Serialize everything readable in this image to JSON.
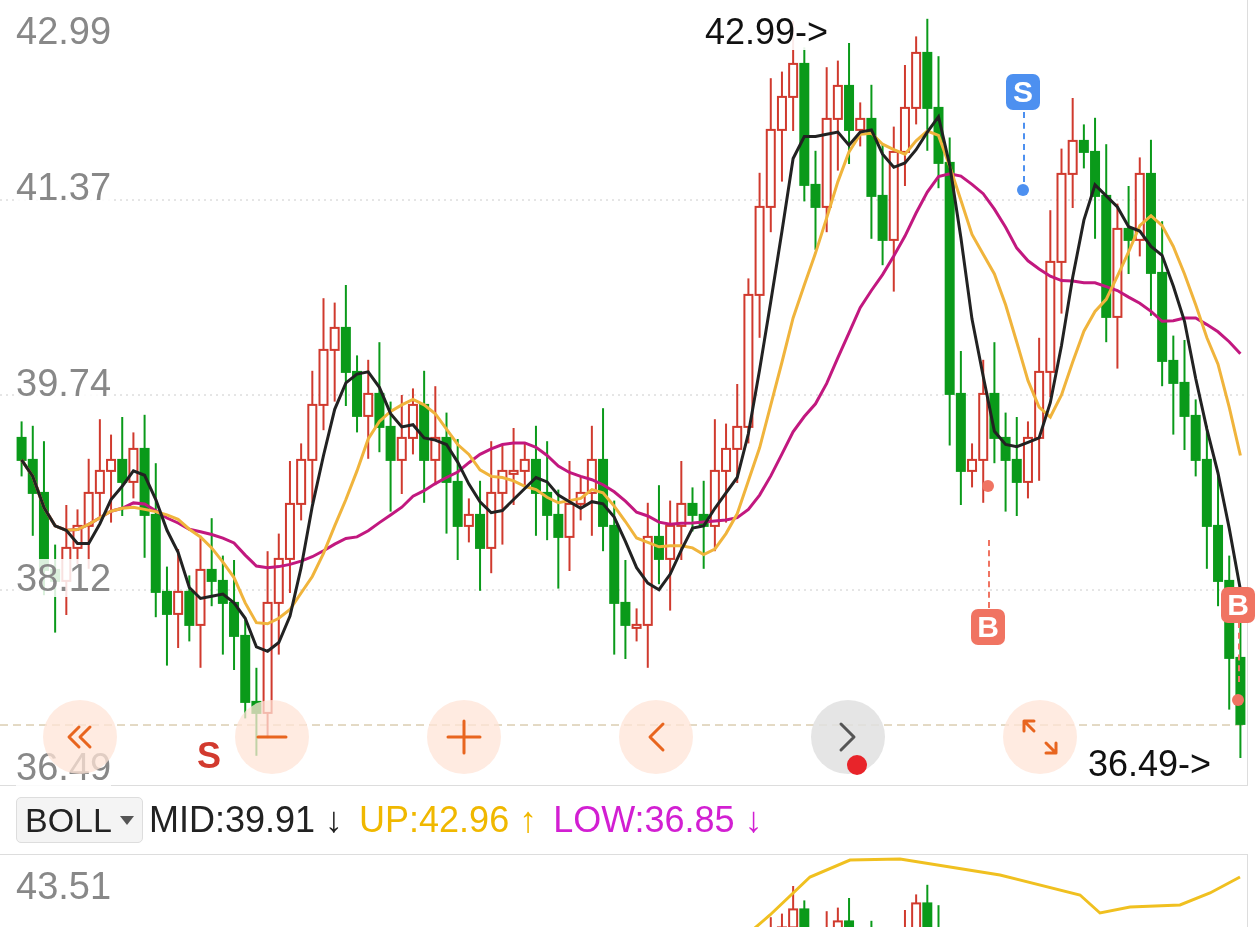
{
  "main_chart": {
    "price_labels": [
      "42.99",
      "41.37",
      "39.74",
      "38.12",
      "36.49"
    ],
    "high_marker": "42.99->",
    "low_marker": "36.49->",
    "trade_mark": "S",
    "signals": [
      {
        "kind": "sell",
        "label": "S"
      },
      {
        "kind": "buy",
        "label": "B"
      },
      {
        "kind": "buy",
        "label": "B"
      }
    ]
  },
  "controls": [
    {
      "kind": "fast-back",
      "active": false
    },
    {
      "kind": "zoom-out",
      "active": false
    },
    {
      "kind": "zoom-in",
      "active": false
    },
    {
      "kind": "prev",
      "active": false
    },
    {
      "kind": "next",
      "active": true
    },
    {
      "kind": "expand",
      "active": false
    }
  ],
  "indicator": {
    "name": "BOLL",
    "values": [
      {
        "label": "MID:39.91",
        "arrow": "↓",
        "color": "#222222"
      },
      {
        "label": "UP:42.96",
        "arrow": "↑",
        "color": "#f0b800"
      },
      {
        "label": "LOW:36.85",
        "arrow": "↓",
        "color": "#d21fd2"
      }
    ]
  },
  "sub_chart": {
    "price_label": "43.51"
  }
}
